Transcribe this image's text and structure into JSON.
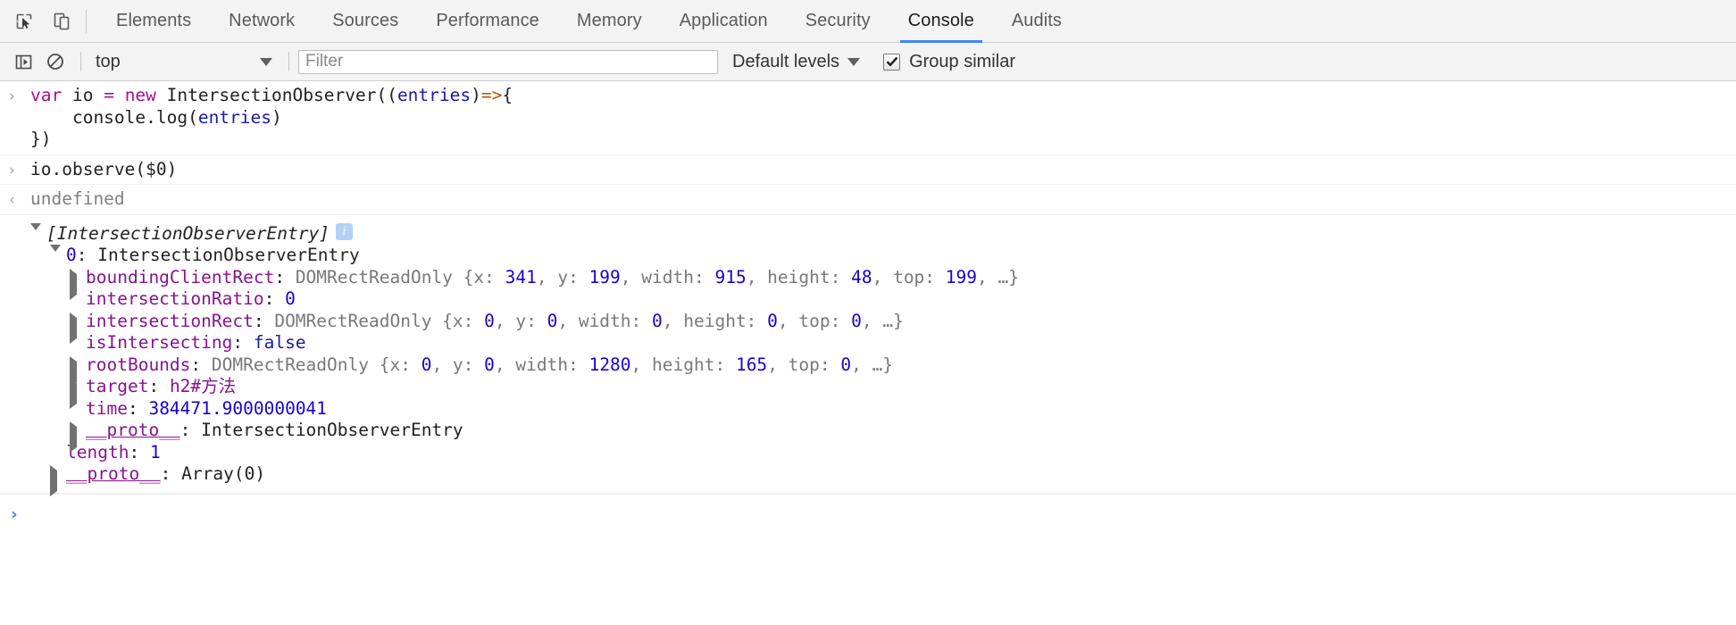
{
  "tabbar": {
    "icons": [
      {
        "name": "inspect-element-icon",
        "label": "Inspect element"
      },
      {
        "name": "device-toolbar-icon",
        "label": "Toggle device toolbar"
      }
    ],
    "tabs": [
      {
        "label": "Elements",
        "selected": false
      },
      {
        "label": "Network",
        "selected": false
      },
      {
        "label": "Sources",
        "selected": false
      },
      {
        "label": "Performance",
        "selected": false
      },
      {
        "label": "Memory",
        "selected": false
      },
      {
        "label": "Application",
        "selected": false
      },
      {
        "label": "Security",
        "selected": false
      },
      {
        "label": "Console",
        "selected": true
      },
      {
        "label": "Audits",
        "selected": false
      }
    ]
  },
  "filterbar": {
    "sidebar_toggle": "console-sidebar-icon",
    "clear_console": "clear-console-icon",
    "context": "top",
    "filter_placeholder": "Filter",
    "filter_value": "",
    "levels_label": "Default levels",
    "group_similar_label": "Group similar",
    "group_similar_checked": true,
    "accent": "#4285f4"
  },
  "console": {
    "input_gutter": "›",
    "output_gutter": "‹",
    "input1": {
      "line1": [
        {
          "t": "var ",
          "c": "kw"
        },
        {
          "t": "io ",
          "c": "plain"
        },
        {
          "t": "= ",
          "c": "kw"
        },
        {
          "t": "new ",
          "c": "kw"
        },
        {
          "t": "IntersectionObserver((",
          "c": "plain"
        },
        {
          "t": "entries",
          "c": "ident"
        },
        {
          "t": ")",
          "c": "plain"
        },
        {
          "t": "=>",
          "c": "op"
        },
        {
          "t": "{",
          "c": "plain"
        }
      ],
      "line2": [
        {
          "t": "    console.log(",
          "c": "plain"
        },
        {
          "t": "entries",
          "c": "ident"
        },
        {
          "t": ")",
          "c": "plain"
        }
      ],
      "line3": [
        {
          "t": "})",
          "c": "plain"
        }
      ]
    },
    "input2": [
      {
        "t": "io.observe($0)",
        "c": "plain"
      }
    ],
    "output1": "undefined",
    "tree": {
      "array_header": "[IntersectionObserverEntry]",
      "info_badge": "i",
      "entry_index": "0",
      "entry_type": "IntersectionObserverEntry",
      "props": [
        {
          "name": "boundingClientRect",
          "expandable": true,
          "ctor": "DOMRectReadOnly",
          "preview": [
            {
              "t": "{x: ",
              "c": "propdim"
            },
            {
              "t": "341",
              "c": "num"
            },
            {
              "t": ", y: ",
              "c": "propdim"
            },
            {
              "t": "199",
              "c": "num"
            },
            {
              "t": ", width: ",
              "c": "propdim"
            },
            {
              "t": "915",
              "c": "num"
            },
            {
              "t": ", height: ",
              "c": "propdim"
            },
            {
              "t": "48",
              "c": "num"
            },
            {
              "t": ", top: ",
              "c": "propdim"
            },
            {
              "t": "199",
              "c": "num"
            },
            {
              "t": ", …}",
              "c": "propdim"
            }
          ]
        },
        {
          "name": "intersectionRatio",
          "expandable": false,
          "ctor": "",
          "preview": [
            {
              "t": "0",
              "c": "num"
            }
          ]
        },
        {
          "name": "intersectionRect",
          "expandable": true,
          "ctor": "DOMRectReadOnly",
          "preview": [
            {
              "t": "{x: ",
              "c": "propdim"
            },
            {
              "t": "0",
              "c": "num"
            },
            {
              "t": ", y: ",
              "c": "propdim"
            },
            {
              "t": "0",
              "c": "num"
            },
            {
              "t": ", width: ",
              "c": "propdim"
            },
            {
              "t": "0",
              "c": "num"
            },
            {
              "t": ", height: ",
              "c": "propdim"
            },
            {
              "t": "0",
              "c": "num"
            },
            {
              "t": ", top: ",
              "c": "propdim"
            },
            {
              "t": "0",
              "c": "num"
            },
            {
              "t": ", …}",
              "c": "propdim"
            }
          ]
        },
        {
          "name": "isIntersecting",
          "expandable": false,
          "ctor": "",
          "preview": [
            {
              "t": "false",
              "c": "ident"
            }
          ]
        },
        {
          "name": "rootBounds",
          "expandable": true,
          "ctor": "DOMRectReadOnly",
          "preview": [
            {
              "t": "{x: ",
              "c": "propdim"
            },
            {
              "t": "0",
              "c": "num"
            },
            {
              "t": ", y: ",
              "c": "propdim"
            },
            {
              "t": "0",
              "c": "num"
            },
            {
              "t": ", width: ",
              "c": "propdim"
            },
            {
              "t": "1280",
              "c": "num"
            },
            {
              "t": ", height: ",
              "c": "propdim"
            },
            {
              "t": "165",
              "c": "num"
            },
            {
              "t": ", top: ",
              "c": "propdim"
            },
            {
              "t": "0",
              "c": "num"
            },
            {
              "t": ", …}",
              "c": "propdim"
            }
          ]
        },
        {
          "name": "target",
          "expandable": true,
          "ctor": "",
          "preview": [
            {
              "t": "h2#方法",
              "c": "prop"
            }
          ]
        },
        {
          "name": "time",
          "expandable": false,
          "ctor": "",
          "preview": [
            {
              "t": "384471.9000000041",
              "c": "num"
            }
          ]
        },
        {
          "name": "__proto__",
          "expandable": true,
          "ctor": "",
          "link": true,
          "preview": [
            {
              "t": "IntersectionObserverEntry",
              "c": "plain"
            }
          ]
        }
      ],
      "length_name": "length",
      "length_value": "1",
      "array_proto_name": "__proto__",
      "array_proto_value": "Array(0)"
    }
  }
}
